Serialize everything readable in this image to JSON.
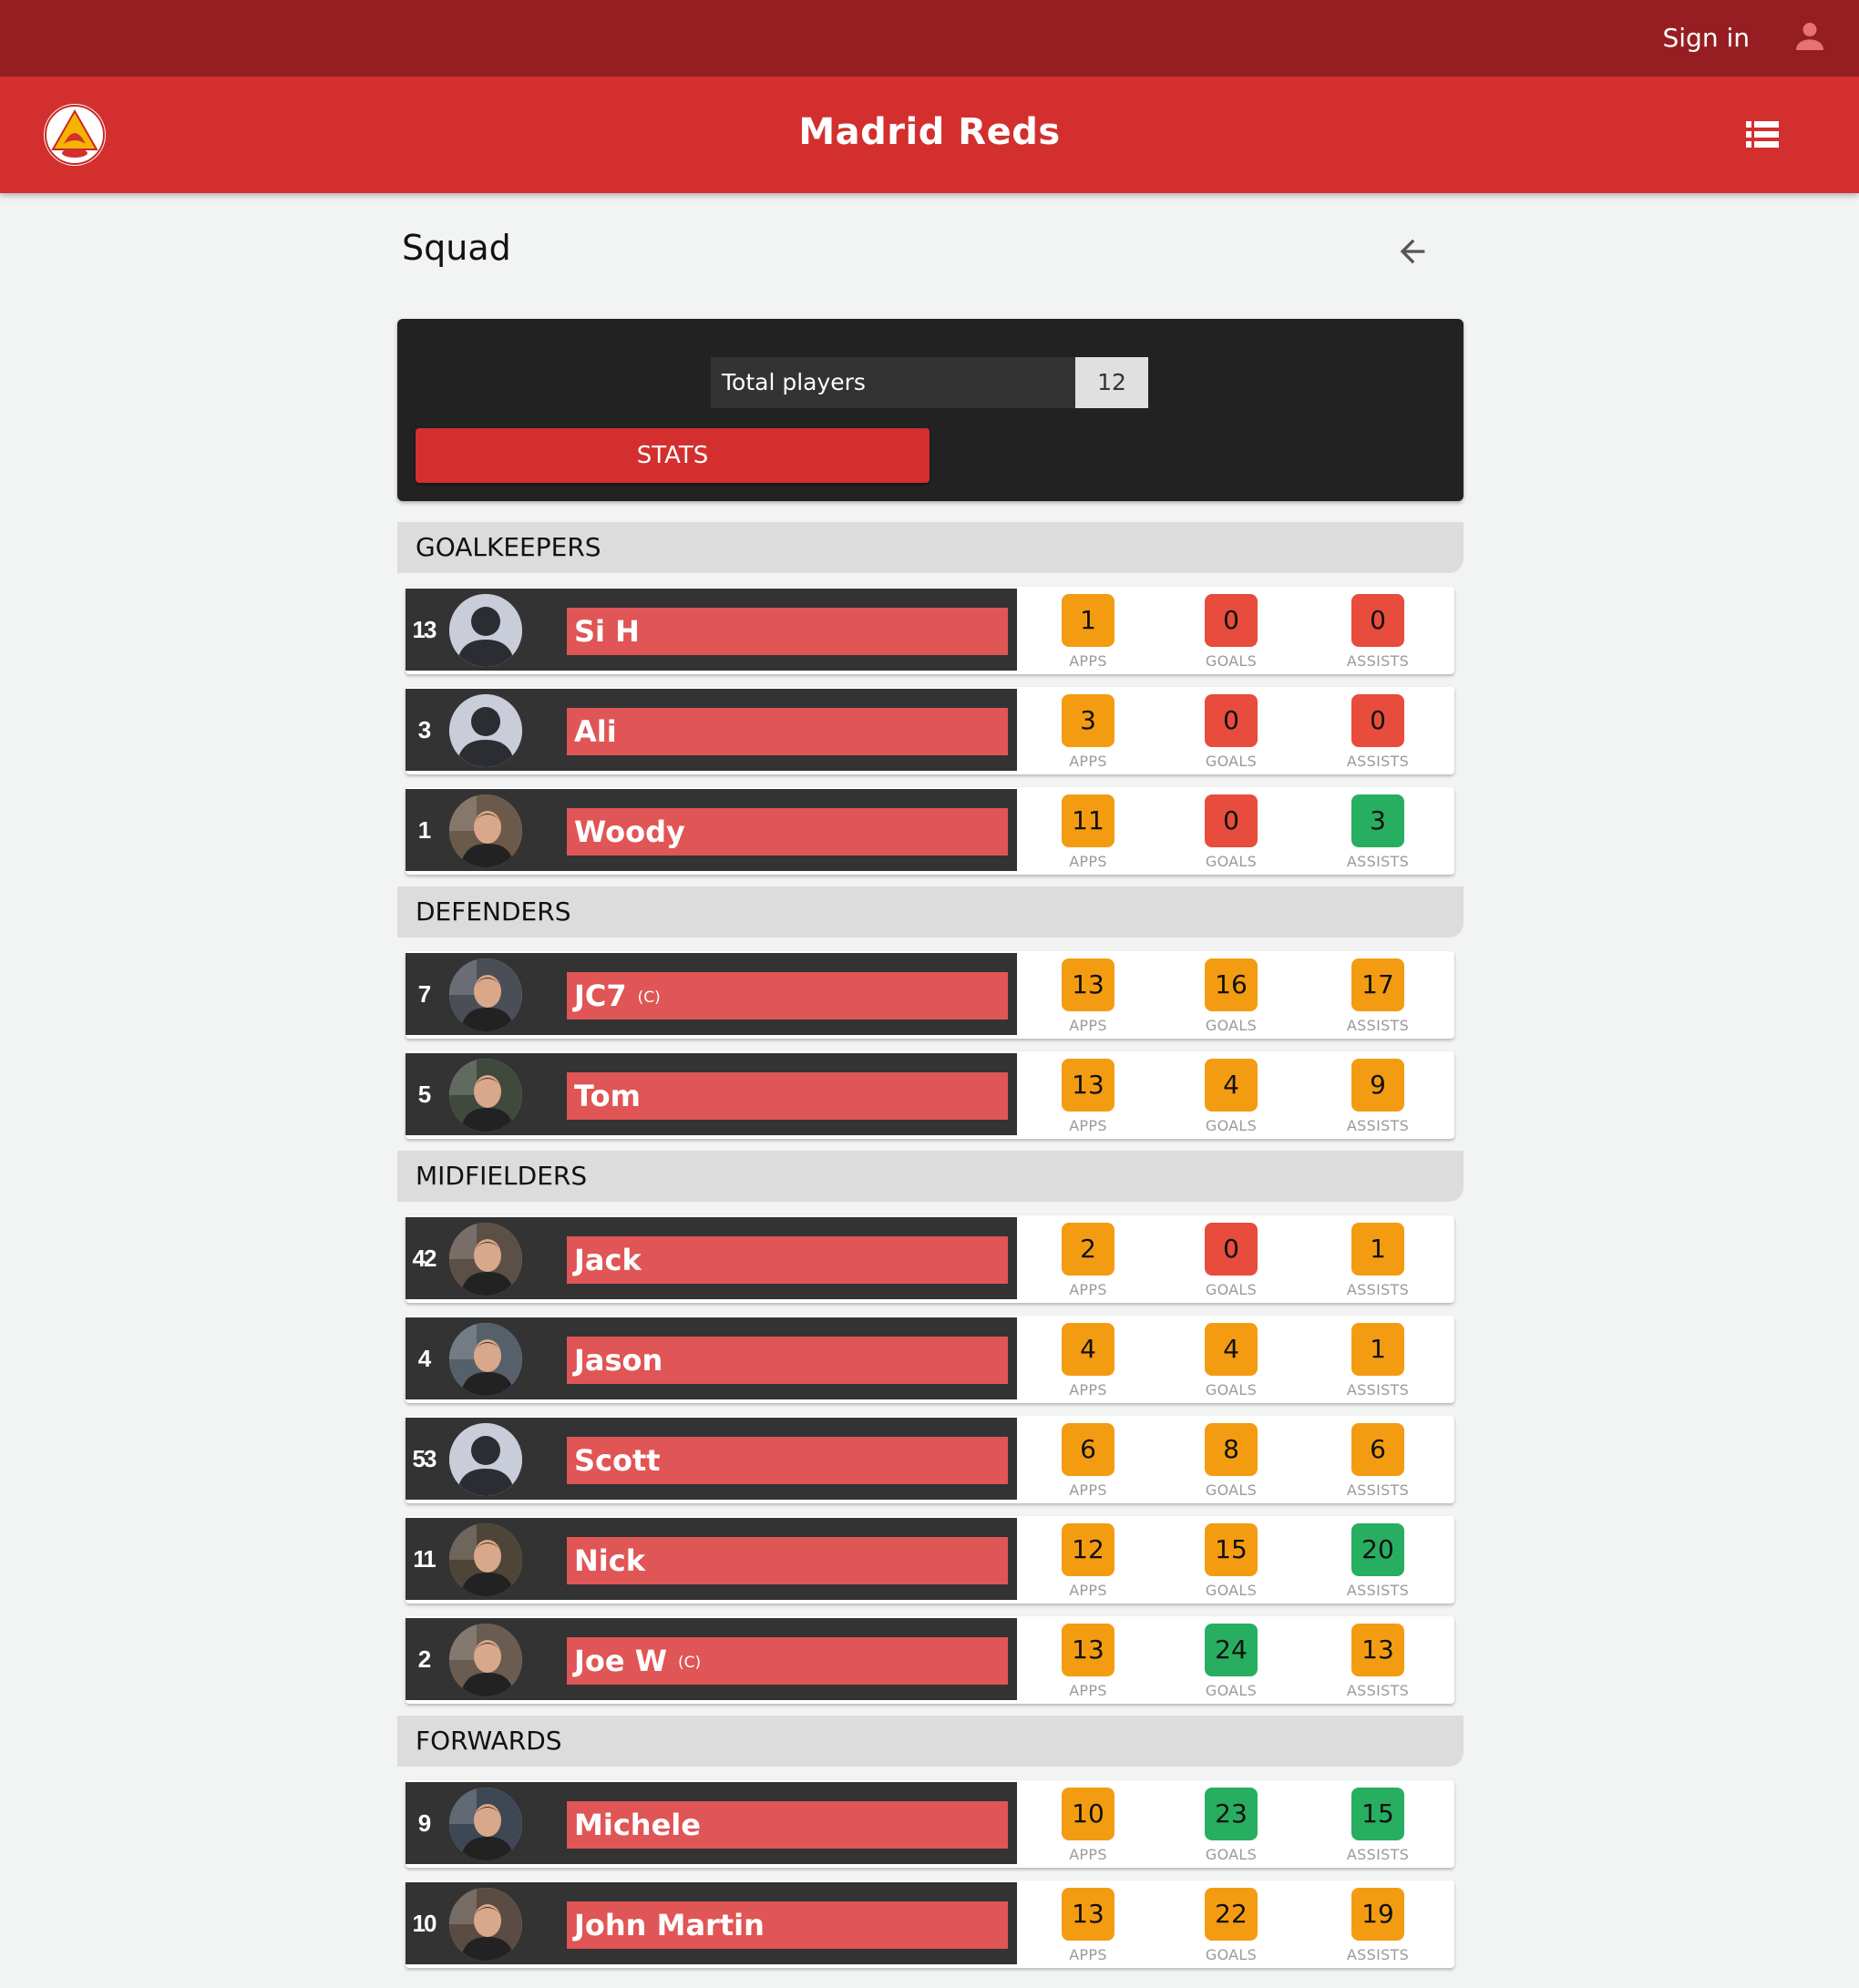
{
  "topbar": {
    "signin_label": "Sign in",
    "user_icon": "person-icon",
    "color": "#961e22"
  },
  "appbar": {
    "title": "Madrid Reds",
    "logo": "club-crest-logo",
    "menu_icon": "list-icon",
    "color": "#d32f2f"
  },
  "page": {
    "title": "Squad",
    "back_icon": "arrow-back-icon"
  },
  "summary": {
    "total_label": "Total players",
    "total_value": "12",
    "stats_button": "STATS"
  },
  "stat_labels": {
    "apps": "APPS",
    "goals": "GOALS",
    "assists": "ASSISTS"
  },
  "stat_colors": {
    "orange": "#f39c12",
    "red": "#e74c3c",
    "green": "#27ae60"
  },
  "sections": [
    {
      "title": "GOALKEEPERS",
      "players": [
        {
          "number": "13",
          "name": "Si H",
          "captain": "",
          "avatar": "placeholder",
          "apps": "1",
          "goals": "0",
          "assists": "0",
          "colors": [
            "orange",
            "red",
            "red"
          ]
        },
        {
          "number": "3",
          "name": "Ali",
          "captain": "",
          "avatar": "placeholder",
          "apps": "3",
          "goals": "0",
          "assists": "0",
          "colors": [
            "orange",
            "red",
            "red"
          ]
        },
        {
          "number": "1",
          "name": "Woody",
          "captain": "",
          "avatar": "photo",
          "apps": "11",
          "goals": "0",
          "assists": "3",
          "colors": [
            "orange",
            "red",
            "green"
          ]
        }
      ]
    },
    {
      "title": "DEFENDERS",
      "players": [
        {
          "number": "7",
          "name": "JC7",
          "captain": "(C)",
          "avatar": "photo",
          "apps": "13",
          "goals": "16",
          "assists": "17",
          "colors": [
            "orange",
            "orange",
            "orange"
          ]
        },
        {
          "number": "5",
          "name": "Tom",
          "captain": "",
          "avatar": "photo",
          "apps": "13",
          "goals": "4",
          "assists": "9",
          "colors": [
            "orange",
            "orange",
            "orange"
          ]
        }
      ]
    },
    {
      "title": "MIDFIELDERS",
      "players": [
        {
          "number": "42",
          "name": "Jack",
          "captain": "",
          "avatar": "photo",
          "apps": "2",
          "goals": "0",
          "assists": "1",
          "colors": [
            "orange",
            "red",
            "orange"
          ]
        },
        {
          "number": "4",
          "name": "Jason",
          "captain": "",
          "avatar": "photo",
          "apps": "4",
          "goals": "4",
          "assists": "1",
          "colors": [
            "orange",
            "orange",
            "orange"
          ]
        },
        {
          "number": "53",
          "name": "Scott",
          "captain": "",
          "avatar": "placeholder",
          "apps": "6",
          "goals": "8",
          "assists": "6",
          "colors": [
            "orange",
            "orange",
            "orange"
          ]
        },
        {
          "number": "11",
          "name": "Nick",
          "captain": "",
          "avatar": "photo",
          "apps": "12",
          "goals": "15",
          "assists": "20",
          "colors": [
            "orange",
            "orange",
            "green"
          ]
        },
        {
          "number": "2",
          "name": "Joe W",
          "captain": "(C)",
          "avatar": "photo",
          "apps": "13",
          "goals": "24",
          "assists": "13",
          "colors": [
            "orange",
            "green",
            "orange"
          ]
        }
      ]
    },
    {
      "title": "FORWARDS",
      "players": [
        {
          "number": "9",
          "name": "Michele",
          "captain": "",
          "avatar": "photo",
          "apps": "10",
          "goals": "23",
          "assists": "15",
          "colors": [
            "orange",
            "green",
            "green"
          ]
        },
        {
          "number": "10",
          "name": "John Martin",
          "captain": "",
          "avatar": "photo",
          "apps": "13",
          "goals": "22",
          "assists": "19",
          "colors": [
            "orange",
            "orange",
            "orange"
          ]
        }
      ]
    }
  ]
}
